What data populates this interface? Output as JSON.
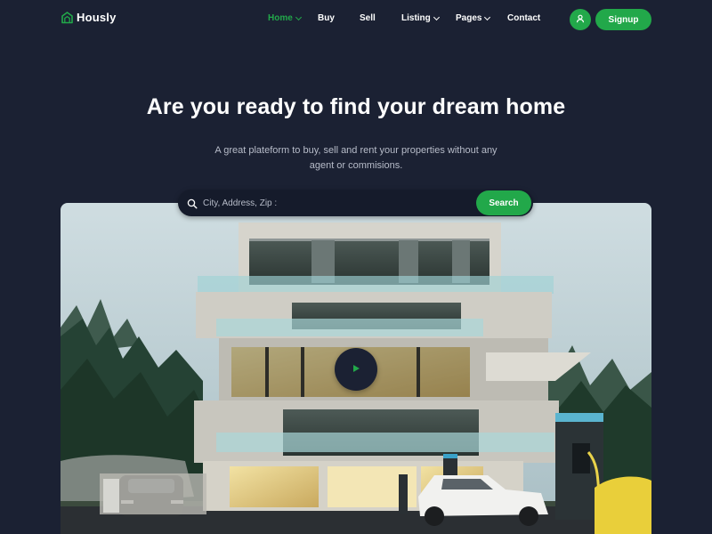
{
  "brand": {
    "name": "Hously",
    "accent": "#22a84a",
    "background": "#1b2133"
  },
  "nav": {
    "items": [
      {
        "label": "Home",
        "has_dropdown": true,
        "active": true
      },
      {
        "label": "Buy",
        "has_dropdown": false,
        "active": false
      },
      {
        "label": "Sell",
        "has_dropdown": false,
        "active": false
      },
      {
        "label": "Listing",
        "has_dropdown": true,
        "active": false
      },
      {
        "label": "Pages",
        "has_dropdown": true,
        "active": false
      },
      {
        "label": "Contact",
        "has_dropdown": false,
        "active": false
      }
    ],
    "user_icon": "user-icon",
    "signup_label": "Signup"
  },
  "hero": {
    "title": "Are you ready to find your dream home",
    "subtitle": "A great plateform to buy, sell and rent your properties without any agent or commisions."
  },
  "search": {
    "placeholder": "City, Address, Zip :",
    "value": "",
    "button_label": "Search",
    "icon": "search-icon"
  },
  "media": {
    "play_icon": "play-icon"
  }
}
